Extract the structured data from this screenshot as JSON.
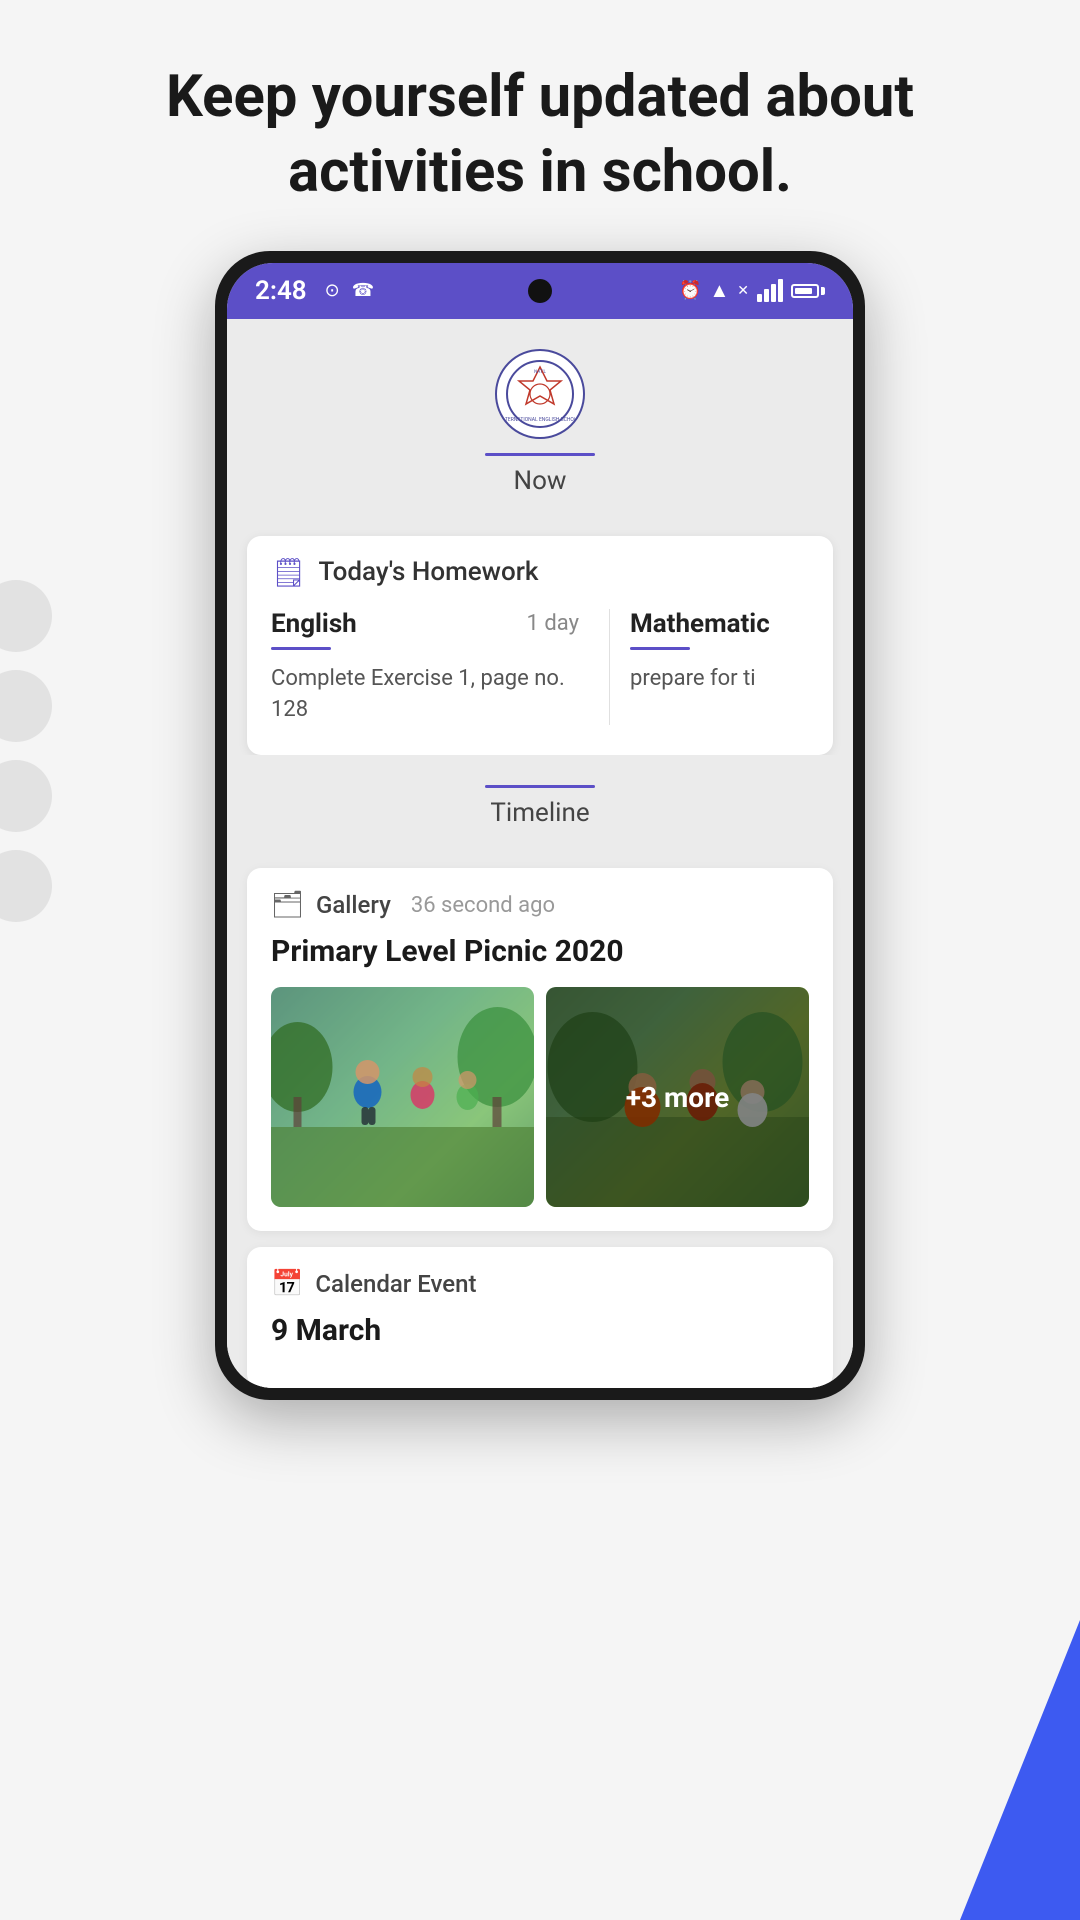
{
  "page": {
    "header_title": "Keep yourself updated about activities in school.",
    "background_color": "#f0f0f0"
  },
  "status_bar": {
    "time": "2:48",
    "bg_color": "#5c4fc7"
  },
  "now_section": {
    "label": "Now",
    "tab_underline_color": "#5c4fc7"
  },
  "homework": {
    "section_title": "Today's Homework",
    "subjects": [
      {
        "name": "English",
        "days": "1 day",
        "description": "Complete Exercise 1, page no. 128"
      },
      {
        "name": "Mathematic",
        "days": "",
        "description": "prepare for ti"
      }
    ]
  },
  "timeline": {
    "label": "Timeline",
    "gallery_card": {
      "type": "Gallery",
      "time": "36 second ago",
      "title": "Primary Level Picnic 2020",
      "more_count": "+3 more"
    },
    "calendar_card": {
      "type": "Calendar Event",
      "date": "9 March"
    }
  },
  "icons": {
    "homework": "📋",
    "gallery": "🗂",
    "calendar": "📅"
  }
}
